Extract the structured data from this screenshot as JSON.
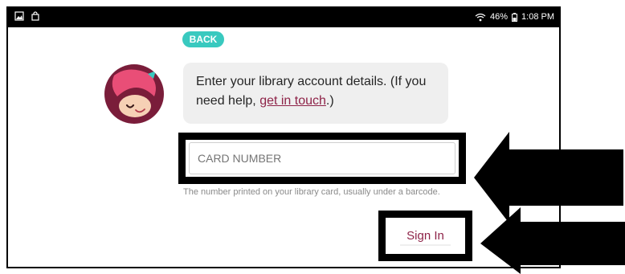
{
  "status_bar": {
    "left_icons": [
      "gallery-icon",
      "shopping-bag-icon"
    ],
    "right_icons": [
      "wifi-icon",
      "battery-icon"
    ],
    "battery": "46%",
    "time": "1:08 PM"
  },
  "back_button_label": "BACK",
  "message": {
    "text_before": "Enter your library account details. (If you need help, ",
    "link_text": "get in touch",
    "text_after": ".)"
  },
  "card_number": {
    "placeholder": "CARD NUMBER",
    "helper": "The number printed on your library card, usually under a barcode."
  },
  "sign_in_label": "Sign In",
  "colors": {
    "accent": "#39c9bf",
    "brand": "#8e2348",
    "avatar_bg": "#7a1d3a",
    "bubble_bg": "#efefef",
    "annotation": "#000000"
  },
  "annotations": {
    "arrow_icons": [
      "arrow-left-icon",
      "arrow-left-icon"
    ]
  }
}
